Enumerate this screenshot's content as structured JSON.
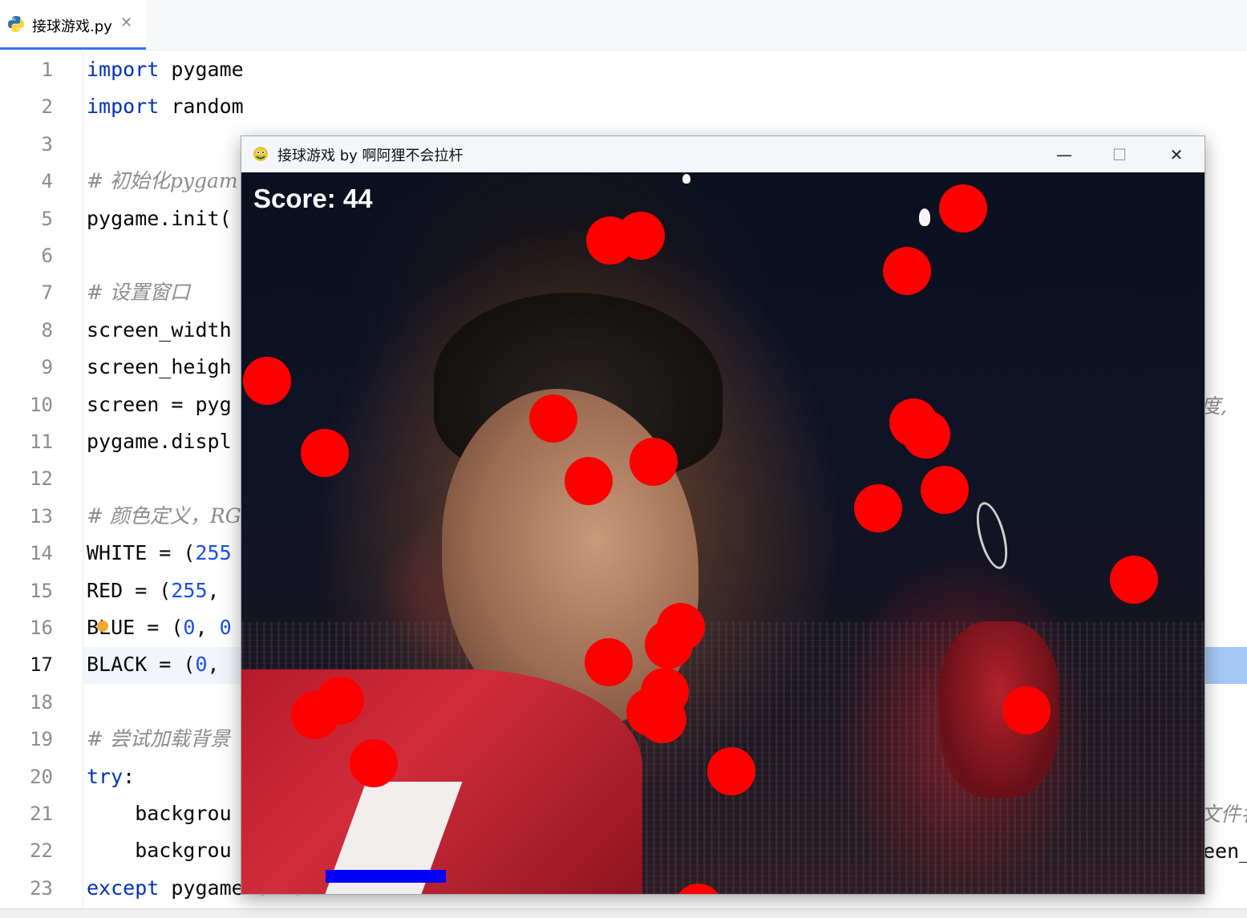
{
  "editor": {
    "tab": {
      "filename": "接球游戏.py",
      "close_glyph": "✕"
    },
    "current_line": 17,
    "line_numbers": [
      "1",
      "2",
      "3",
      "4",
      "5",
      "6",
      "7",
      "8",
      "9",
      "10",
      "11",
      "12",
      "13",
      "14",
      "15",
      "16",
      "17",
      "18",
      "19",
      "20",
      "21",
      "22",
      "23"
    ],
    "lines": [
      {
        "n": 1,
        "tokens": [
          {
            "t": "import",
            "k": "kw"
          },
          {
            "t": " pygame",
            "k": ""
          }
        ]
      },
      {
        "n": 2,
        "tokens": [
          {
            "t": "import",
            "k": "kw"
          },
          {
            "t": " random",
            "k": ""
          }
        ]
      },
      {
        "n": 3,
        "tokens": []
      },
      {
        "n": 4,
        "tokens": [
          {
            "t": "# 初始化pygam",
            "k": "cm"
          }
        ]
      },
      {
        "n": 5,
        "tokens": [
          {
            "t": "pygame.init(",
            "k": ""
          }
        ]
      },
      {
        "n": 6,
        "tokens": []
      },
      {
        "n": 7,
        "tokens": [
          {
            "t": "# 设置窗口",
            "k": "cm"
          }
        ]
      },
      {
        "n": 8,
        "tokens": [
          {
            "t": "screen_width",
            "k": ""
          }
        ]
      },
      {
        "n": 9,
        "tokens": [
          {
            "t": "screen_heigh",
            "k": ""
          }
        ]
      },
      {
        "n": 10,
        "tokens": [
          {
            "t": "screen = pyg",
            "k": ""
          }
        ]
      },
      {
        "n": 11,
        "tokens": [
          {
            "t": "pygame.displ",
            "k": ""
          }
        ]
      },
      {
        "n": 12,
        "tokens": []
      },
      {
        "n": 13,
        "tokens": [
          {
            "t": "# 颜色定义，RG",
            "k": "cm"
          }
        ]
      },
      {
        "n": 14,
        "tokens": [
          {
            "t": "WHITE = (",
            "k": ""
          },
          {
            "t": "255",
            "k": "num"
          }
        ]
      },
      {
        "n": 15,
        "tokens": [
          {
            "t": "RED = (",
            "k": ""
          },
          {
            "t": "255",
            "k": "num"
          },
          {
            "t": ",",
            "k": ""
          }
        ]
      },
      {
        "n": 16,
        "tokens": [
          {
            "t": "BLUE = (",
            "k": ""
          },
          {
            "t": "0",
            "k": "num"
          },
          {
            "t": ", ",
            "k": ""
          },
          {
            "t": "0",
            "k": "num"
          }
        ]
      },
      {
        "n": 17,
        "tokens": [
          {
            "t": "BLACK = (",
            "k": ""
          },
          {
            "t": "0",
            "k": "num"
          },
          {
            "t": ",",
            "k": ""
          }
        ]
      },
      {
        "n": 18,
        "tokens": []
      },
      {
        "n": 19,
        "tokens": [
          {
            "t": "# 尝试加载背景",
            "k": "cm"
          }
        ]
      },
      {
        "n": 20,
        "tokens": [
          {
            "t": "try",
            "k": "kw"
          },
          {
            "t": ":",
            "k": ""
          }
        ]
      },
      {
        "n": 21,
        "tokens": [
          {
            "t": "    backgrou",
            "k": ""
          }
        ]
      },
      {
        "n": 22,
        "tokens": [
          {
            "t": "    backgrou",
            "k": ""
          }
        ]
      },
      {
        "n": 23,
        "tokens": [
          {
            "t": "except",
            "k": "kw"
          },
          {
            "t": " pygame.error:",
            "k": ""
          }
        ]
      }
    ],
    "right_fragments": {
      "line10": "度,",
      "line21": "文件名",
      "line22": "een_"
    }
  },
  "game_window": {
    "title": "接球游戏 by 啊阿狸不会拉杆",
    "minimize_glyph": "—",
    "maximize_glyph": "☐",
    "close_glyph": "✕",
    "score_text": "Score: 44",
    "ball_color": "#ff0000",
    "paddle_color": "#0000ff"
  }
}
